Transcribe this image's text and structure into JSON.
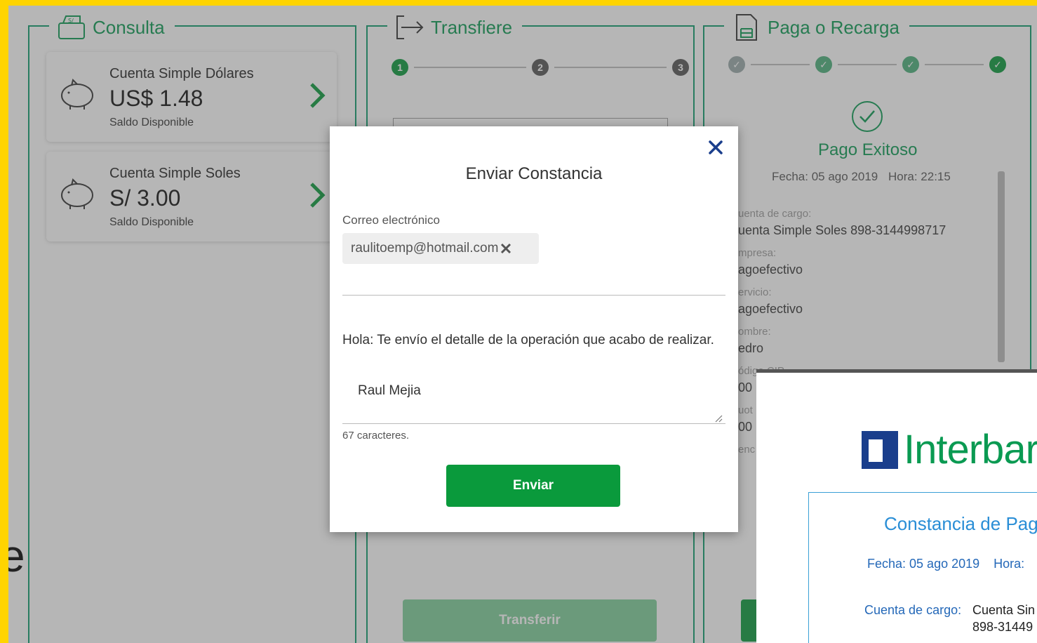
{
  "consulta": {
    "title": "Consulta",
    "accounts": [
      {
        "name": "Cuenta Simple Dólares",
        "amount": "US$ 1.48",
        "caption": "Saldo Disponible"
      },
      {
        "name": "Cuenta Simple Soles",
        "amount": "S/ 3.00",
        "caption": "Saldo Disponible"
      }
    ]
  },
  "transfiere": {
    "title": "Transfiere",
    "steps": [
      "1",
      "2",
      "3"
    ],
    "button": "Transferir"
  },
  "paga": {
    "title": "Paga o Recarga",
    "status": "Pago Exitoso",
    "fecha": "Fecha: 05 ago 2019",
    "hora": "Hora: 22:15",
    "fields": [
      {
        "label": "uenta de cargo:",
        "value": "uenta Simple Soles 898-3144998717"
      },
      {
        "label": "mpresa:",
        "value": "agoefectivo"
      },
      {
        "label": "ervicio:",
        "value": "agoefectivo"
      },
      {
        "label": "ombre:",
        "value": "edro"
      },
      {
        "label": "ódigo CIP",
        "value": "00"
      },
      {
        "label": "uot",
        "value": "00"
      },
      {
        "label": "enc",
        "value": ""
      }
    ]
  },
  "modal": {
    "title": "Enviar Constancia",
    "email_label": "Correo electrónico",
    "email_chip": "raulitoemp@hotmail.com",
    "message_line": "Hola: Te envío el detalle de la operación que acabo de realizar.",
    "message_signature": "Raul Mejia",
    "counter": "67 caracteres.",
    "send_label": "Enviar"
  },
  "receipt": {
    "brand": "Interbar",
    "title": "Constancia de Pag",
    "fecha": "Fecha: 05 ago 2019",
    "hora": "Hora: ",
    "cargo_label": "Cuenta de cargo:",
    "cargo_value": "Cuenta Sin",
    "cargo_value2": "898-31449"
  },
  "edge_letter": "e",
  "colors": {
    "brand_green": "#0a9a52",
    "button_green": "#0a9a3c",
    "close_blue": "#1a3e8c",
    "frame_yellow": "#ffd400"
  }
}
